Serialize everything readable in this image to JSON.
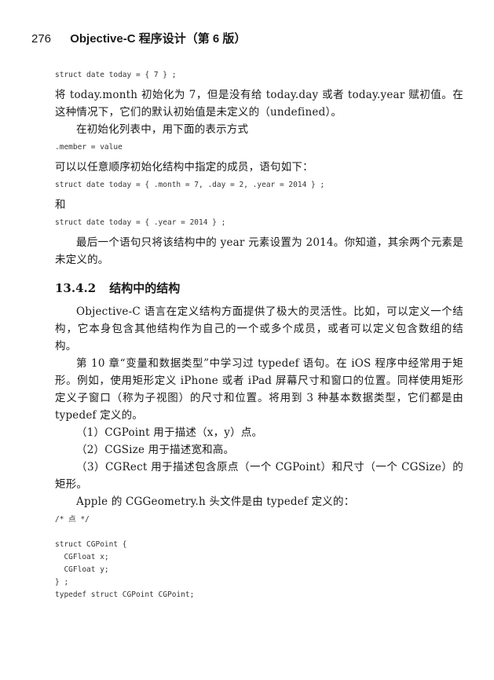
{
  "header": {
    "page_number": "276",
    "book_title": "Objective-C 程序设计（第 6 版）"
  },
  "code1": "struct date today = { 7 } ;",
  "para1": "将 today.month 初始化为 7，但是没有给 today.day 或者 today.year 赋初值。在这种情况下，它们的默认初始值是未定义的（undefined）。",
  "para2": "在初始化列表中，用下面的表示方式",
  "code2": ".member = value",
  "para3": "可以以任意顺序初始化结构中指定的成员，语句如下：",
  "code3": "struct date today = { .month = 7, .day = 2, .year = 2014 } ;",
  "para4": "和",
  "code4": "struct date today = { .year = 2014 } ;",
  "para5": "最后一个语句只将该结构中的 year 元素设置为 2014。你知道，其余两个元素是未定义的。",
  "section": {
    "number": "13.4.2",
    "title": "结构中的结构"
  },
  "para6": "Objective-C 语言在定义结构方面提供了极大的灵活性。比如，可以定义一个结构，它本身包含其他结构作为自己的一个或多个成员，或者可以定义包含数组的结构。",
  "para7": "第 10 章“变量和数据类型”中学习过 typedef 语句。在 iOS 程序中经常用于矩形。例如，使用矩形定义 iPhone 或者 iPad 屏幕尺寸和窗口的位置。同样使用矩形定义子窗口（称为子视图）的尺寸和位置。将用到 3 种基本数据类型，它们都是由 typedef 定义的。",
  "list": [
    "（1）CGPoint 用于描述（x，y）点。",
    "（2）CGSize 用于描述宽和高。",
    "（3）CGRect 用于描述包含原点（一个 CGPoint）和尺寸（一个 CGSize）的矩形。"
  ],
  "para8": "Apple 的 CGGeometry.h 头文件是由 typedef 定义的：",
  "code5": "/* 点 */\n\nstruct CGPoint {\n  CGFloat x;\n  CGFloat y;\n} ;\ntypedef struct CGPoint CGPoint;"
}
